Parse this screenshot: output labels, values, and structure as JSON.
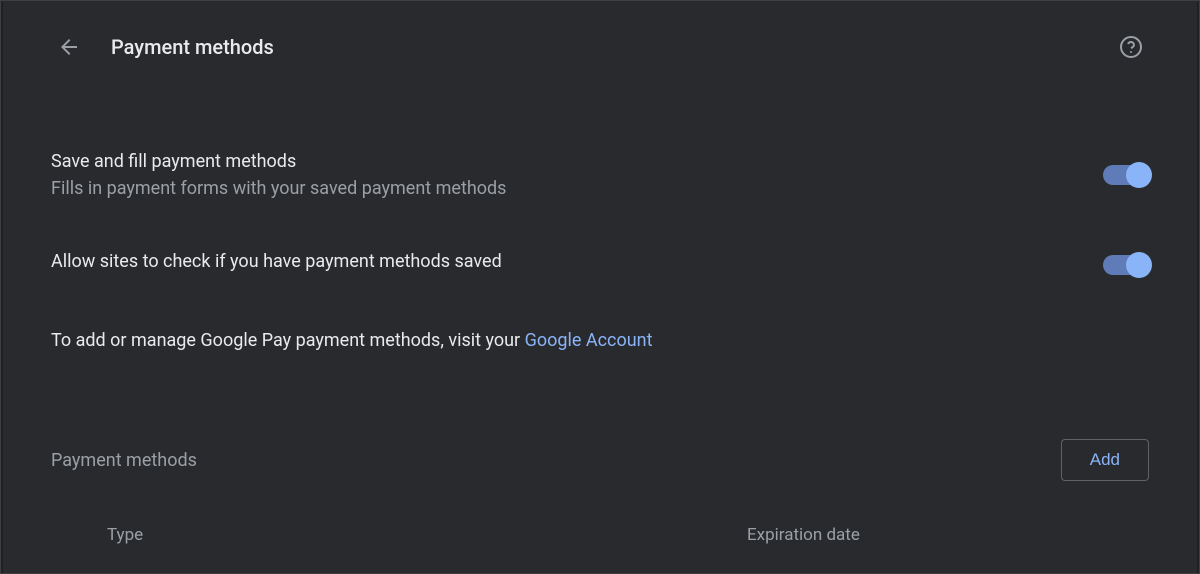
{
  "header": {
    "title": "Payment methods"
  },
  "settings": {
    "saveAndFill": {
      "title": "Save and fill payment methods",
      "description": "Fills in payment forms with your saved payment methods",
      "enabled": true
    },
    "allowSitesCheck": {
      "title": "Allow sites to check if you have payment methods saved",
      "enabled": true
    }
  },
  "infoText": {
    "prefix": "To add or manage Google Pay payment methods, visit your ",
    "linkText": "Google Account"
  },
  "section": {
    "title": "Payment methods",
    "addButton": "Add"
  },
  "table": {
    "columns": {
      "type": "Type",
      "expiry": "Expiration date"
    }
  }
}
